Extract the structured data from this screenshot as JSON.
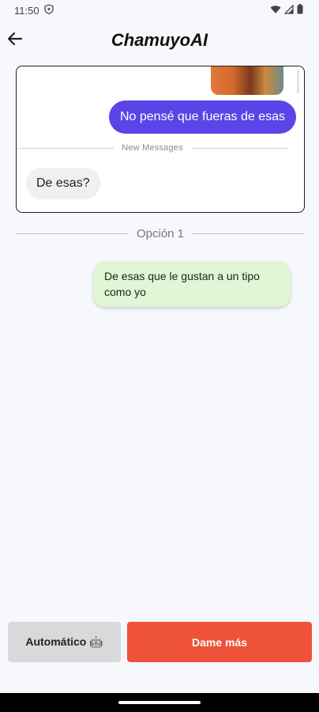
{
  "status_bar": {
    "time": "11:50",
    "icons": [
      "shield-icon",
      "wifi-icon",
      "signal-icon",
      "battery-icon"
    ]
  },
  "app_bar": {
    "title": "ChamuyoAI",
    "back_icon": "arrow-left-icon"
  },
  "conversation_preview": {
    "sent_message": "No pensé que fueras de esas",
    "divider_label": "New Messages",
    "received_message": "De esas?"
  },
  "options": [
    {
      "label": "Opción 1",
      "suggestion": "De esas que le gustan a un tipo como yo"
    }
  ],
  "actions": {
    "auto_label": "Automático 🤖",
    "more_label": "Dame más"
  },
  "colors": {
    "sent_bubble": "#5b45e8",
    "suggestion_bubble": "#dff7d4",
    "primary_button": "#ee5238",
    "secondary_button": "#d9d9dc"
  }
}
